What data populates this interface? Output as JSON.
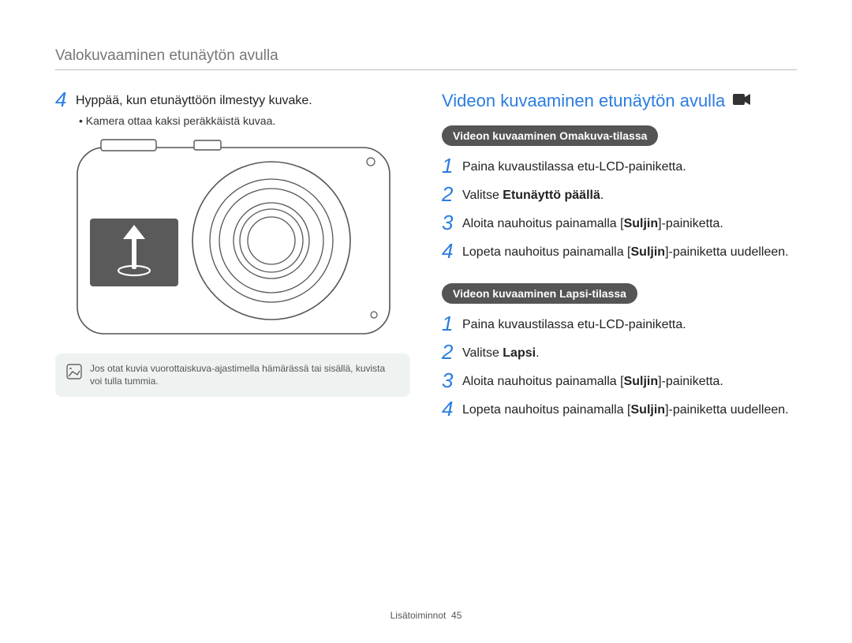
{
  "header": "Valokuvaaminen etunäytön avulla",
  "left": {
    "step4_num": "4",
    "step4_text": "Hyppää, kun etunäyttöön ilmestyy kuvake.",
    "bullet": "Kamera ottaa kaksi peräkkäistä kuvaa.",
    "note": "Jos otat kuvia vuorottaiskuva-ajastimella hämärässä tai sisällä, kuvista voi tulla tummia."
  },
  "right": {
    "title": "Videon kuvaaminen etunäytön avulla",
    "section_a": {
      "pill": "Videon kuvaaminen Omakuva-tilassa",
      "s1_num": "1",
      "s1_text": "Paina kuvaustilassa etu-LCD-painiketta.",
      "s2_num": "2",
      "s2_pre": "Valitse ",
      "s2_bold": "Etunäyttö päällä",
      "s2_post": ".",
      "s3_num": "3",
      "s3_pre": "Aloita nauhoitus painamalla [",
      "s3_bold": "Suljin",
      "s3_post": "]-painiketta.",
      "s4_num": "4",
      "s4_pre": "Lopeta nauhoitus painamalla [",
      "s4_bold": "Suljin",
      "s4_post": "]-painiketta uudelleen."
    },
    "section_b": {
      "pill": "Videon kuvaaminen Lapsi-tilassa",
      "s1_num": "1",
      "s1_text": "Paina kuvaustilassa etu-LCD-painiketta.",
      "s2_num": "2",
      "s2_pre": "Valitse ",
      "s2_bold": "Lapsi",
      "s2_post": ".",
      "s3_num": "3",
      "s3_pre": "Aloita nauhoitus painamalla [",
      "s3_bold": "Suljin",
      "s3_post": "]-painiketta.",
      "s4_num": "4",
      "s4_pre": "Lopeta nauhoitus painamalla [",
      "s4_bold": "Suljin",
      "s4_post": "]-painiketta uudelleen."
    }
  },
  "footer": {
    "label": "Lisätoiminnot",
    "page": "45"
  }
}
